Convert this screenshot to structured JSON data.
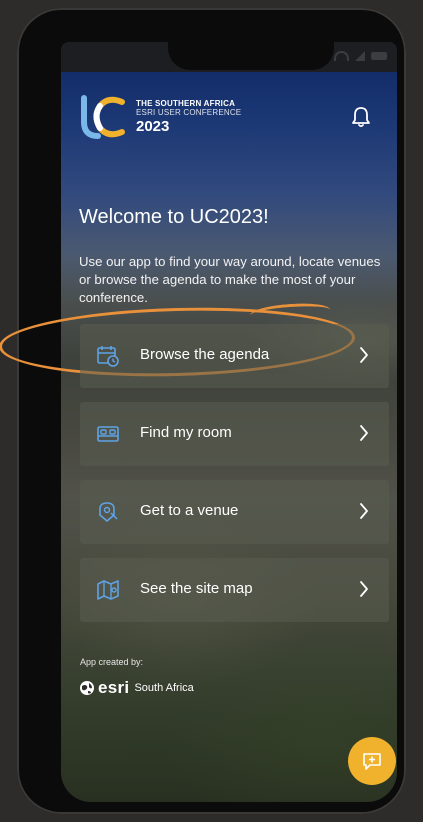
{
  "app": {
    "logo_line1": "THE SOUTHERN AFRICA",
    "logo_line2": "ESRI USER CONFERENCE",
    "logo_year": "2023"
  },
  "header": {
    "welcome": "Welcome to UC2023!",
    "intro": "Use our app to find your way around, locate venues or browse the agenda to make the most of your conference."
  },
  "menu": [
    {
      "label": "Browse the agenda",
      "icon": "calendar-clock-icon"
    },
    {
      "label": "Find my room",
      "icon": "bed-icon"
    },
    {
      "label": "Get to a venue",
      "icon": "venue-pin-icon"
    },
    {
      "label": "See the site map",
      "icon": "map-icon"
    }
  ],
  "footer": {
    "created_by": "App created by:",
    "brand": "esri",
    "region": "South Africa"
  },
  "colors": {
    "accent": "#f0b12c",
    "highlight": "#e8913a",
    "icon_blue": "#5fa3e6"
  }
}
